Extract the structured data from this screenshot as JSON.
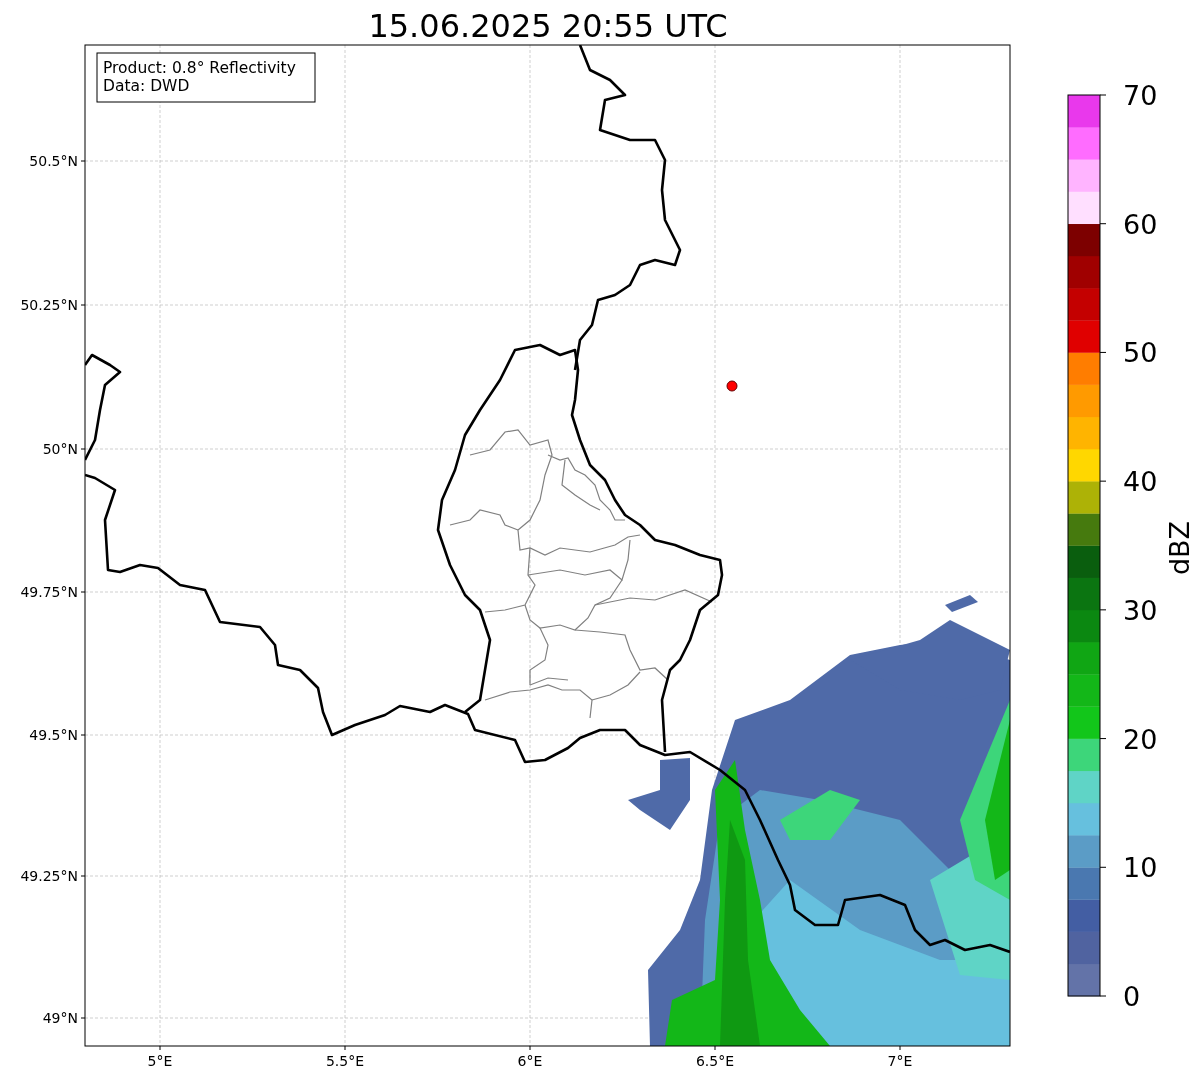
{
  "title": "15.06.2025 20:55 UTC",
  "info_box": {
    "lines": [
      "Product: 0.8° Reflectivity",
      "Data: DWD"
    ]
  },
  "map": {
    "x_ticks": [
      "5°E",
      "5.5°E",
      "6°E",
      "6.5°E",
      "7°E"
    ],
    "y_ticks": [
      "50.5°N",
      "50.25°N",
      "50°N",
      "49.75°N",
      "49.5°N",
      "49.25°N",
      "49°N"
    ]
  },
  "colorbar": {
    "label": "dBZ",
    "ticks": [
      "70",
      "60",
      "50",
      "40",
      "30",
      "20",
      "10",
      "0"
    ],
    "bands": [
      {
        "color": "#6373a8"
      },
      {
        "color": "#5063a0"
      },
      {
        "color": "#435ea3"
      },
      {
        "color": "#4a78b0"
      },
      {
        "color": "#5b9cc6"
      },
      {
        "color": "#66c0de"
      },
      {
        "color": "#5fd4c6"
      },
      {
        "color": "#3dd67a"
      },
      {
        "color": "#12c61a"
      },
      {
        "color": "#13b718"
      },
      {
        "color": "#10a614"
      },
      {
        "color": "#0b8811"
      },
      {
        "color": "#0b7511"
      },
      {
        "color": "#0a5e0e"
      },
      {
        "color": "#467a0e"
      },
      {
        "color": "#adb206"
      },
      {
        "color": "#ffd700"
      },
      {
        "color": "#ffb400"
      },
      {
        "color": "#ff9a00"
      },
      {
        "color": "#ff7d00"
      },
      {
        "color": "#e00000"
      },
      {
        "color": "#c40000"
      },
      {
        "color": "#a00000"
      },
      {
        "color": "#7d0000"
      },
      {
        "color": "#ffdfff"
      },
      {
        "color": "#ffb4ff"
      },
      {
        "color": "#ff6cff"
      },
      {
        "color": "#e938ec"
      }
    ]
  }
}
